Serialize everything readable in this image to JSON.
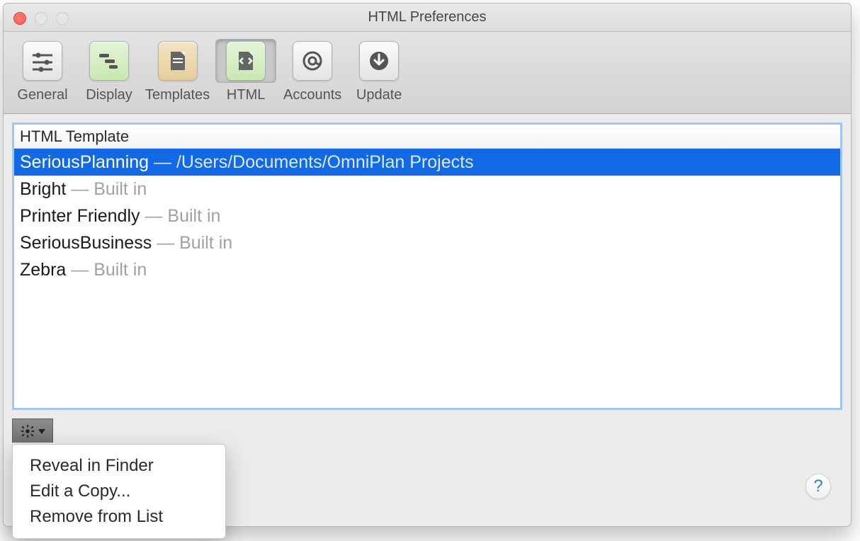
{
  "window": {
    "title": "HTML Preferences"
  },
  "toolbar": {
    "items": [
      {
        "label": "General",
        "active": false
      },
      {
        "label": "Display",
        "active": false
      },
      {
        "label": "Templates",
        "active": false
      },
      {
        "label": "HTML",
        "active": true
      },
      {
        "label": "Accounts",
        "active": false
      },
      {
        "label": "Update",
        "active": false
      }
    ]
  },
  "list": {
    "header": "HTML Template",
    "separator": " — ",
    "builtin_label": "Built in",
    "rows": [
      {
        "name": "SeriousPlanning",
        "subtitle": "/Users/Documents/OmniPlan Projects",
        "selected": true,
        "builtin": false
      },
      {
        "name": "Bright",
        "subtitle": "Built in",
        "selected": false,
        "builtin": true
      },
      {
        "name": "Printer Friendly",
        "subtitle": "Built in",
        "selected": false,
        "builtin": true
      },
      {
        "name": "SeriousBusiness",
        "subtitle": "Built in",
        "selected": false,
        "builtin": true
      },
      {
        "name": "Zebra",
        "subtitle": "Built in",
        "selected": false,
        "builtin": true
      }
    ]
  },
  "context_menu": {
    "items": [
      "Reveal in Finder",
      "Edit a Copy...",
      "Remove from List"
    ]
  },
  "help": {
    "glyph": "?"
  }
}
